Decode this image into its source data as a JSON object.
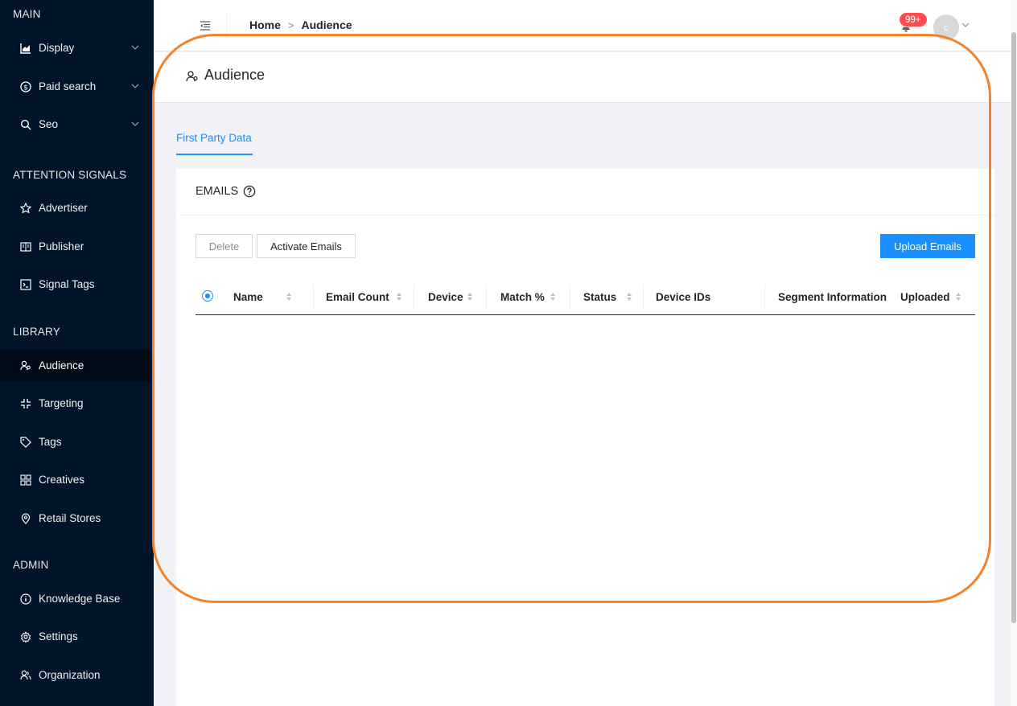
{
  "sidebar": {
    "sections": [
      {
        "title": "MAIN",
        "items": [
          {
            "label": "Display",
            "icon": "area-chart-icon",
            "has_submenu": true
          },
          {
            "label": "Paid search",
            "icon": "dollar-circle-icon",
            "has_submenu": true
          },
          {
            "label": "Seo",
            "icon": "search-icon",
            "has_submenu": true
          }
        ]
      },
      {
        "title": "ATTENTION SIGNALS",
        "items": [
          {
            "label": "Advertiser",
            "icon": "star-icon"
          },
          {
            "label": "Publisher",
            "icon": "book-icon"
          },
          {
            "label": "Signal Tags",
            "icon": "code-icon"
          }
        ]
      },
      {
        "title": "LIBRARY",
        "items": [
          {
            "label": "Audience",
            "icon": "users-icon",
            "active": true
          },
          {
            "label": "Targeting",
            "icon": "compress-icon"
          },
          {
            "label": "Tags",
            "icon": "tag-icon"
          },
          {
            "label": "Creatives",
            "icon": "grid-icon"
          },
          {
            "label": "Retail Stores",
            "icon": "location-pin-icon"
          }
        ]
      },
      {
        "title": "ADMIN",
        "items": [
          {
            "label": "Knowledge Base",
            "icon": "info-circle-icon"
          },
          {
            "label": "Settings",
            "icon": "gear-icon"
          },
          {
            "label": "Organization",
            "icon": "team-icon"
          }
        ]
      }
    ]
  },
  "header": {
    "breadcrumb": [
      "Home",
      "Audience"
    ],
    "notification_badge": "99+",
    "avatar_initial": "c"
  },
  "page": {
    "title": "Audience",
    "tabs": [
      "First Party Data"
    ],
    "card": {
      "title": "EMAILS",
      "buttons": {
        "delete": "Delete",
        "activate": "Activate Emails",
        "upload": "Upload Emails"
      },
      "columns": [
        "Name",
        "Email Count",
        "Device",
        "Match %",
        "Status",
        "Device IDs",
        "Segment Information",
        "Uploaded"
      ]
    }
  },
  "colors": {
    "sidebar_bg": "#001529",
    "accent": "#1890ff",
    "badge": "#ff4d4f",
    "highlight": "#f5822a"
  }
}
